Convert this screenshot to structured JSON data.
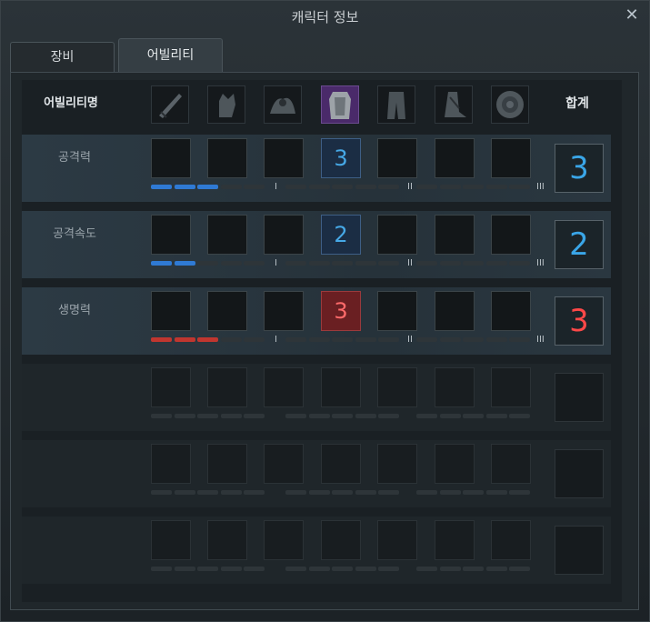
{
  "window": {
    "title": "캐릭터 정보",
    "close_label": "✕"
  },
  "tabs": [
    {
      "label": "장비",
      "active": false
    },
    {
      "label": "어빌리티",
      "active": true
    }
  ],
  "header": {
    "name_label": "어빌리티명",
    "total_label": "합계"
  },
  "equipment_icons": [
    "weapon-icon",
    "glove-icon",
    "shoulder-icon",
    "armor-icon",
    "pants-icon",
    "boots-icon",
    "shield-icon"
  ],
  "rows": [
    {
      "label": "공격력",
      "filled_slot": 4,
      "slot_value": "3",
      "total": "3",
      "color": "blue",
      "progress": 3
    },
    {
      "label": "공격속도",
      "filled_slot": 4,
      "slot_value": "2",
      "total": "2",
      "color": "blue",
      "progress": 2
    },
    {
      "label": "생명력",
      "filled_slot": 4,
      "slot_value": "3",
      "total": "3",
      "color": "red",
      "progress": 3
    },
    {
      "label": "",
      "filled_slot": 0,
      "slot_value": "",
      "total": "",
      "color": "none",
      "progress": 0
    },
    {
      "label": "",
      "filled_slot": 0,
      "slot_value": "",
      "total": "",
      "color": "none",
      "progress": 0
    },
    {
      "label": "",
      "filled_slot": 0,
      "slot_value": "",
      "total": "",
      "color": "none",
      "progress": 0
    }
  ],
  "tier_markers": [
    "I",
    "II",
    "III"
  ],
  "colors": {
    "blue": "#3aa6e8",
    "red": "#ff4848"
  }
}
